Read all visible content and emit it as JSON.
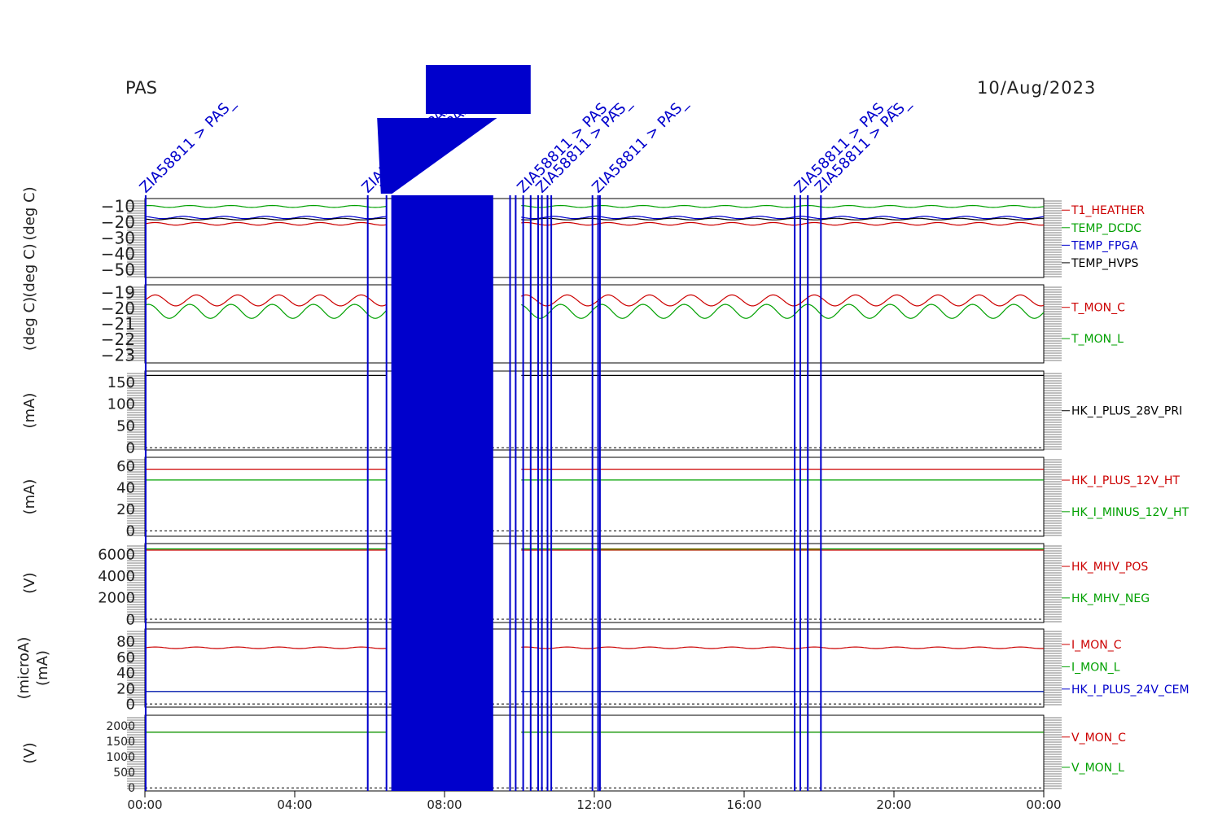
{
  "header": {
    "instrument": "PAS",
    "date": "10/Aug/2023"
  },
  "colors": {
    "red": "#cc0000",
    "green": "#00a000",
    "blue": "#0000cc",
    "black": "#000000",
    "brown": "#8a5a00"
  },
  "event_label_visible": "ZIA58811 > PAS_",
  "chart_data": [
    {
      "type": "line",
      "ylabel": "(deg C)",
      "ylabel2": "(deg C)",
      "ylim": [
        -55,
        -5
      ],
      "yticks": [
        -10,
        -20,
        -30,
        -40,
        -50
      ],
      "x_range_hours": [
        0,
        24
      ],
      "xticks": [
        "00:00",
        "04:00",
        "08:00",
        "12:00",
        "16:00",
        "20:00",
        "00:00"
      ],
      "series": [
        {
          "name": "T1_HEATHER",
          "color": "red",
          "level": -21,
          "amp": 0.8
        },
        {
          "name": "TEMP_DCDC",
          "color": "green",
          "level": -10,
          "amp": 0.6
        },
        {
          "name": "TEMP_FPGA",
          "color": "blue",
          "level": -17,
          "amp": 0.7
        },
        {
          "name": "TEMP_HVPS",
          "color": "black",
          "level": -18,
          "amp": 0.5
        }
      ]
    },
    {
      "type": "line",
      "ylabel": "(deg C)",
      "ylim": [
        -23.5,
        -18.5
      ],
      "yticks": [
        -19,
        -20,
        -21,
        -22,
        -23
      ],
      "series": [
        {
          "name": "T_MON_C",
          "color": "red",
          "level": -19.5,
          "amp": 0.35
        },
        {
          "name": "T_MON_L",
          "color": "green",
          "level": -20.2,
          "amp": 0.45
        }
      ]
    },
    {
      "type": "line",
      "ylabel": "(mA)",
      "ylim": [
        -5,
        175
      ],
      "yticks": [
        150,
        100,
        50,
        0
      ],
      "series": [
        {
          "name": "HK_I_PLUS_28V_PRI",
          "color": "black",
          "level": 165,
          "amp": 0
        }
      ]
    },
    {
      "type": "line",
      "ylabel": "(mA)",
      "ylim": [
        -5,
        68
      ],
      "yticks": [
        60,
        40,
        20,
        0
      ],
      "series": [
        {
          "name": "HK_I_PLUS_12V_HT",
          "color": "red",
          "level": 57,
          "amp": 0
        },
        {
          "name": "HK_I_MINUS_12V_HT",
          "color": "green",
          "level": 47,
          "amp": 0
        }
      ]
    },
    {
      "type": "line",
      "ylabel": "(V)",
      "ylim": [
        -300,
        7000
      ],
      "yticks": [
        6000,
        4000,
        2000,
        0
      ],
      "series": [
        {
          "name": "HK_MHV_POS",
          "color": "red",
          "level": 6400,
          "amp": 0
        },
        {
          "name": "HK_MHV_NEG",
          "color": "green",
          "level": 6500,
          "amp": 0
        }
      ]
    },
    {
      "type": "line",
      "ylabel": "(microA)",
      "ylabel2": "(mA)",
      "ylim": [
        -4,
        96
      ],
      "yticks": [
        80,
        60,
        40,
        20,
        0
      ],
      "series": [
        {
          "name": "I_MON_C",
          "color": "red",
          "level": 72,
          "amp": 1
        },
        {
          "name": "I_MON_L",
          "color": "green",
          "level": 16,
          "amp": 0
        },
        {
          "name": "HK_I_PLUS_24V_CEM",
          "color": "blue",
          "level": 16,
          "amp": 0
        }
      ]
    },
    {
      "type": "line",
      "ylabel": "(V)",
      "ylim": [
        -100,
        2350
      ],
      "yticks": [
        2000,
        1500,
        1000,
        500,
        0
      ],
      "series": [
        {
          "name": "V_MON_C",
          "color": "red",
          "level": 1800,
          "amp": 0
        },
        {
          "name": "V_MON_L",
          "color": "green",
          "level": 1800,
          "amp": 0
        }
      ]
    }
  ],
  "events_hours": [
    0.02,
    5.95,
    6.45,
    6.6,
    9.75,
    9.9,
    10.1,
    10.3,
    10.5,
    10.6,
    10.75,
    10.85,
    11.95,
    12.1,
    12.15,
    17.35,
    17.5,
    17.7,
    18.05
  ],
  "dense_events_hours": [
    6.6,
    9.3
  ]
}
